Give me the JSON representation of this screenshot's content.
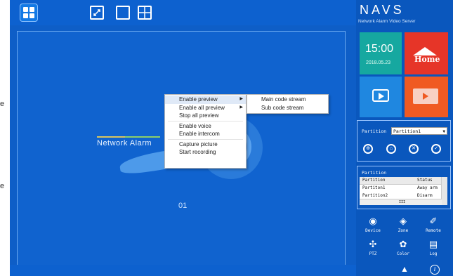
{
  "edge_text": [
    "e",
    "e"
  ],
  "layout_buttons": [
    {
      "icon": "quad-layout-icon"
    },
    {
      "icon": "resize-icon"
    },
    {
      "icon": "single-screen-icon"
    },
    {
      "icon": "four-screen-icon"
    }
  ],
  "viewer": {
    "label": "Network Alarm",
    "slot_number": "01"
  },
  "context_menu": {
    "items": [
      {
        "label": "Enable preview",
        "submenu": true,
        "highlighted": true
      },
      {
        "label": "Enable all preview",
        "submenu": true
      },
      {
        "label": "Stop all preview"
      },
      {
        "label": "Enable voice"
      },
      {
        "label": "Enable intercom"
      },
      {
        "label": "Capture picture"
      },
      {
        "label": "Start recording"
      }
    ],
    "submenu_items": [
      {
        "label": "Main code stream"
      },
      {
        "label": "Sub code stream"
      }
    ]
  },
  "brand": {
    "title": "NAVS",
    "subtitle": "Network Alarm Video Server"
  },
  "status": {
    "time": "15:00",
    "date": "2018.05.23",
    "home_label": "Home"
  },
  "colors": {
    "clock_tile": "#16a8a0",
    "home_tile": "#e63528",
    "video_tile": "#1f87e0",
    "playback_tile": "#f05a22",
    "sidebar": "#0a57bd",
    "main": "#0e5ec7"
  },
  "partition_selector": {
    "label": "Partition",
    "value": "Partition1"
  },
  "partition_controls": [
    "arm-icon",
    "stay-arm-icon",
    "disarm-icon",
    "clear-alarm-icon"
  ],
  "partition_table": {
    "title": "Partition",
    "columns": [
      "Partition",
      "Status"
    ],
    "rows": [
      [
        "Partiton1",
        "Away arm"
      ],
      [
        "Partition2",
        "Disarm"
      ]
    ],
    "scroll_marker": "III"
  },
  "nav": [
    {
      "label": "Device",
      "icon": "device-icon"
    },
    {
      "label": "Zone",
      "icon": "zone-icon"
    },
    {
      "label": "Remote",
      "icon": "remote-icon"
    },
    {
      "label": "PTZ",
      "icon": "ptz-icon"
    },
    {
      "label": "Color",
      "icon": "color-icon"
    },
    {
      "label": "Log",
      "icon": "log-icon"
    }
  ],
  "footer_icons": [
    "alarm-bell-icon",
    "info-icon"
  ]
}
